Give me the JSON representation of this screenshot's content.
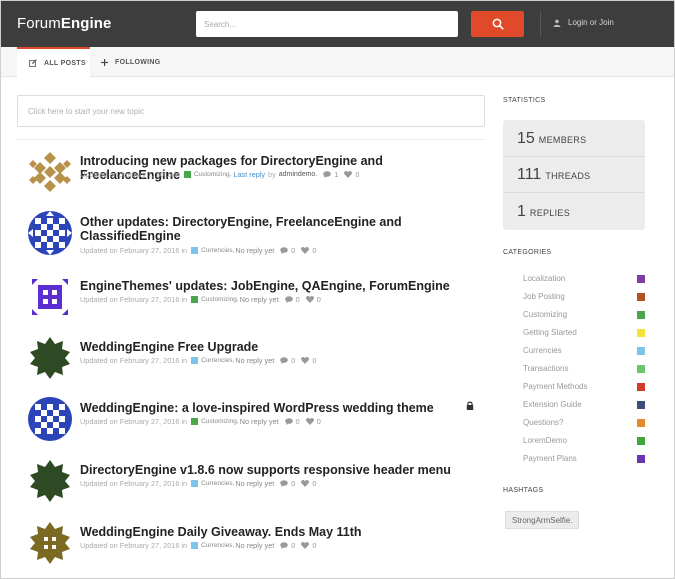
{
  "header": {
    "logo_light": "Forum",
    "logo_bold": "Engine",
    "search_placeholder": "Search...",
    "login_label": "Login or Join"
  },
  "tabs": [
    {
      "label": "ALL POSTS",
      "active": true
    },
    {
      "label": "FOLLOWING",
      "active": false
    }
  ],
  "composer_placeholder": "Click here to start your new topic",
  "posts": [
    {
      "title": "Introducing new packages for DirectoryEngine and FreelanceEngine",
      "updated": "Updated on January 7, 2016 in",
      "category": "Customizing,",
      "category_color": "#4aa64a",
      "reply_prefix": "",
      "reply_link": "Last reply",
      "by": "by",
      "author": "admindemo.",
      "comments": "1",
      "likes": "0",
      "avatar": "diamond-tan"
    },
    {
      "title": "Other updates: DirectoryEngine, FreelanceEngine and ClassifiedEngine",
      "updated": "Updated on February 27, 2016 in",
      "category": "Currencies,",
      "category_color": "#7cc4e8",
      "reply_prefix": "No reply yet",
      "comments": "0",
      "likes": "0",
      "avatar": "blue-grid"
    },
    {
      "title": "EngineThemes' updates: JobEngine, QAEngine, ForumEngine",
      "updated": "Updated on February 27, 2016 in",
      "category": "Customizing,",
      "category_color": "#4aa64a",
      "reply_prefix": "No reply yet",
      "comments": "0",
      "likes": "0",
      "avatar": "purple-blocks"
    },
    {
      "title": "WeddingEngine Free Upgrade",
      "updated": "Updated on February 27, 2016 in",
      "category": "Currencies,",
      "category_color": "#7cc4e8",
      "reply_prefix": "No reply yet",
      "comments": "0",
      "likes": "0",
      "avatar": "green-star"
    },
    {
      "title": "WeddingEngine: a love-inspired WordPress wedding theme",
      "updated": "Updated on February 27, 2016 in",
      "category": "Customizing,",
      "category_color": "#4aa64a",
      "reply_prefix": "No reply yet",
      "comments": "0",
      "likes": "0",
      "avatar": "blue-grid",
      "locked": true
    },
    {
      "title": "DirectoryEngine v1.8.6 now supports responsive header menu",
      "updated": "Updated on February 27, 2016 in",
      "category": "Currencies,",
      "category_color": "#7cc4e8",
      "reply_prefix": "No reply yet",
      "comments": "0",
      "likes": "0",
      "avatar": "green-star"
    },
    {
      "title": "WeddingEngine Daily Giveaway. Ends May 11th",
      "updated": "Updated on February 27, 2016 in",
      "category": "Currencies,",
      "category_color": "#7cc4e8",
      "reply_prefix": "No reply yet",
      "comments": "0",
      "likes": "0",
      "avatar": "olive-star"
    }
  ],
  "sidebar": {
    "statistics_heading": "STATISTICS",
    "stats": [
      {
        "num": "15",
        "label": "MEMBERS"
      },
      {
        "num": "111",
        "label": "THREADS"
      },
      {
        "num": "1",
        "label": "REPLIES"
      }
    ],
    "categories_heading": "CATEGORIES",
    "categories": [
      {
        "label": "Localization",
        "color": "#7a3fa8"
      },
      {
        "label": "Job Posting",
        "color": "#b8501e"
      },
      {
        "label": "Customizing",
        "color": "#4aa64a"
      },
      {
        "label": "Getting Started",
        "color": "#f2e23a"
      },
      {
        "label": "Currencies",
        "color": "#7cc4e8"
      },
      {
        "label": "Transactions",
        "color": "#6ec46e"
      },
      {
        "label": "Payment Methods",
        "color": "#d23a2a"
      },
      {
        "label": "Extension Guide",
        "color": "#3e4d7a"
      },
      {
        "label": "Questions?",
        "color": "#e58a2e"
      },
      {
        "label": "LoremDemo",
        "color": "#3ea83e"
      },
      {
        "label": "Payment Plans",
        "color": "#6a36b0"
      }
    ],
    "hashtags_heading": "HASHTAGS",
    "hashtags": [
      "StrongArmSelfie."
    ]
  },
  "colors": {
    "accent": "#e0492a",
    "header_bg": "#3d3d3d"
  }
}
